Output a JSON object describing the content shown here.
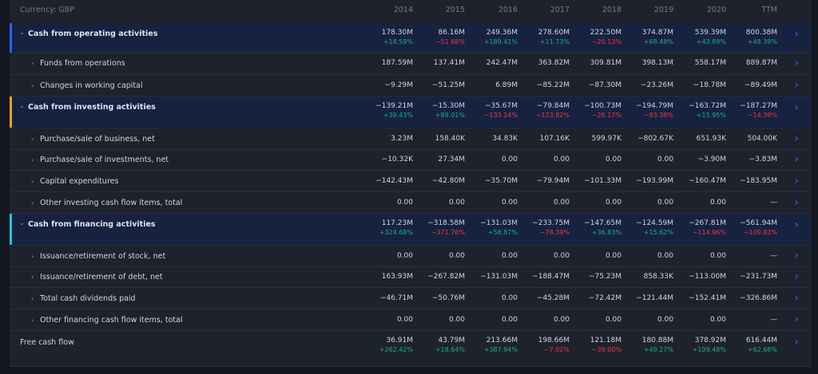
{
  "currency_label": "Currency: GBP",
  "columns": [
    "2014",
    "2015",
    "2016",
    "2017",
    "2018",
    "2019",
    "2020",
    "TTM"
  ],
  "colors": {
    "operating": "#2962ff",
    "investing": "#f59f1a",
    "financing": "#26c6da",
    "positive": "#22ab94",
    "negative": "#f23645",
    "arrow": "#2962ff"
  },
  "rows": [
    {
      "label": "Cash from operating activities",
      "kind": "section",
      "accent": "operating",
      "values": [
        "178.30M",
        "86.16M",
        "249.36M",
        "278.60M",
        "222.50M",
        "374.87M",
        "539.39M",
        "800.38M"
      ],
      "changes": [
        "+18.59%",
        "−51.68%",
        "+189.41%",
        "+11.73%",
        "−20.13%",
        "+68.48%",
        "+43.89%",
        "+48.39%"
      ]
    },
    {
      "label": "Funds from operations",
      "kind": "sub",
      "values": [
        "187.59M",
        "137.41M",
        "242.47M",
        "363.82M",
        "309.81M",
        "398.13M",
        "558.17M",
        "889.87M"
      ]
    },
    {
      "label": "Changes in working capital",
      "kind": "sub",
      "values": [
        "−9.29M",
        "−51.25M",
        "6.89M",
        "−85.22M",
        "−87.30M",
        "−23.26M",
        "−18.78M",
        "−89.49M"
      ]
    },
    {
      "label": "Cash from investing activities",
      "kind": "section",
      "accent": "investing",
      "values": [
        "−139.21M",
        "−15.30M",
        "−35.67M",
        "−79.84M",
        "−100.73M",
        "−194.79M",
        "−163.72M",
        "−187.27M"
      ],
      "changes": [
        "+39.43%",
        "+89.01%",
        "−133.14%",
        "−123.82%",
        "−26.17%",
        "−93.38%",
        "+15.95%",
        "−14.39%"
      ]
    },
    {
      "label": "Purchase/sale of business, net",
      "kind": "sub",
      "values": [
        "3.23M",
        "158.40K",
        "34.83K",
        "107.16K",
        "599.97K",
        "−802.67K",
        "651.93K",
        "504.00K"
      ]
    },
    {
      "label": "Purchase/sale of investments, net",
      "kind": "sub",
      "values": [
        "−10.32K",
        "27.34M",
        "0.00",
        "0.00",
        "0.00",
        "0.00",
        "−3.90M",
        "−3.83M"
      ]
    },
    {
      "label": "Capital expenditures",
      "kind": "sub",
      "values": [
        "−142.43M",
        "−42.80M",
        "−35.70M",
        "−79.94M",
        "−101.33M",
        "−193.99M",
        "−160.47M",
        "−183.95M"
      ]
    },
    {
      "label": "Other investing cash flow items, total",
      "kind": "sub",
      "values": [
        "0.00",
        "0.00",
        "0.00",
        "0.00",
        "0.00",
        "0.00",
        "0.00",
        "—"
      ]
    },
    {
      "label": "Cash from financing activities",
      "kind": "section",
      "accent": "financing",
      "values": [
        "117.23M",
        "−318.58M",
        "−131.03M",
        "−233.75M",
        "−147.65M",
        "−124.59M",
        "−267.81M",
        "−561.94M"
      ],
      "changes": [
        "+324.68%",
        "−371.76%",
        "+58.87%",
        "−78.39%",
        "+36.83%",
        "+15.62%",
        "−114.96%",
        "−109.83%"
      ]
    },
    {
      "label": "Issuance/retirement of stock, net",
      "kind": "sub",
      "values": [
        "0.00",
        "0.00",
        "0.00",
        "0.00",
        "0.00",
        "0.00",
        "0.00",
        "—"
      ]
    },
    {
      "label": "Issuance/retirement of debt, net",
      "kind": "sub",
      "values": [
        "163.93M",
        "−267.82M",
        "−131.03M",
        "−188.47M",
        "−75.23M",
        "858.33K",
        "−113.00M",
        "−231.73M"
      ]
    },
    {
      "label": "Total cash dividends paid",
      "kind": "sub",
      "values": [
        "−46.71M",
        "−50.76M",
        "0.00",
        "−45.28M",
        "−72.42M",
        "−121.44M",
        "−152.41M",
        "−326.86M"
      ]
    },
    {
      "label": "Other financing cash flow items, total",
      "kind": "sub",
      "values": [
        "0.00",
        "0.00",
        "0.00",
        "0.00",
        "0.00",
        "0.00",
        "0.00",
        "—"
      ]
    },
    {
      "label": "Free cash flow",
      "kind": "plain",
      "values": [
        "36.91M",
        "43.79M",
        "213.66M",
        "198.66M",
        "121.18M",
        "180.88M",
        "378.92M",
        "616.44M"
      ],
      "changes": [
        "+262.42%",
        "+18.64%",
        "+387.94%",
        "−7.02%",
        "−39.00%",
        "+49.27%",
        "+109.48%",
        "+62.68%"
      ]
    }
  ]
}
